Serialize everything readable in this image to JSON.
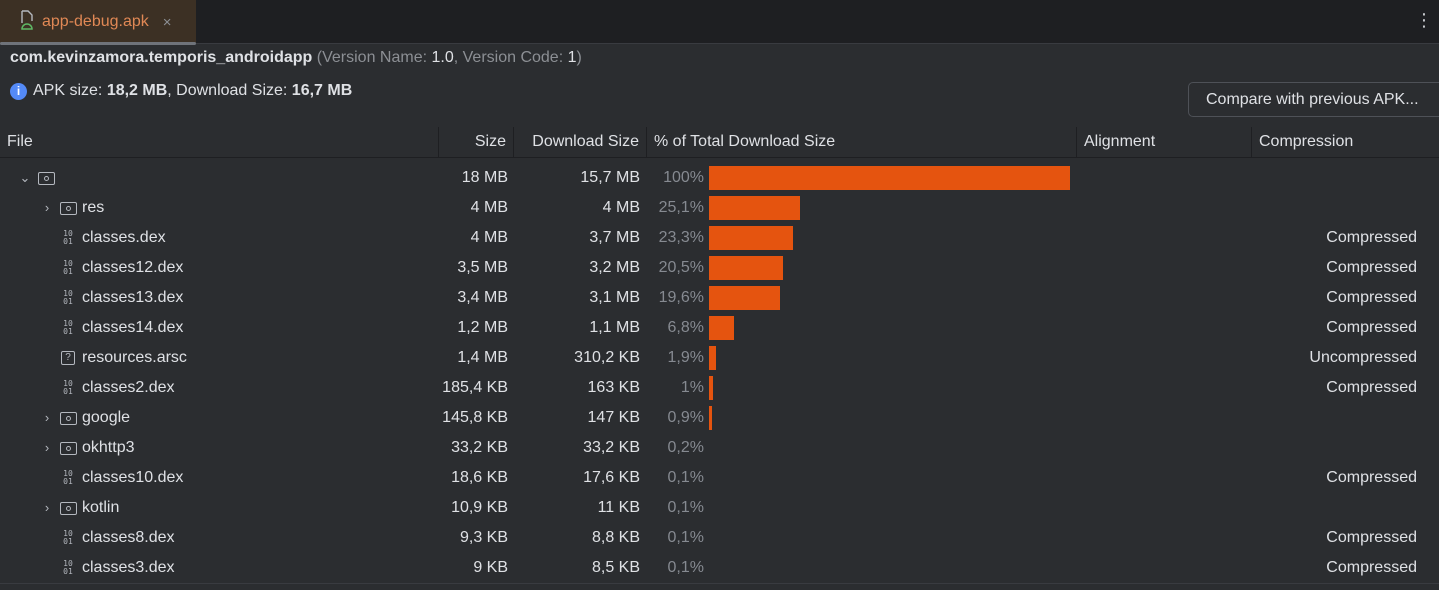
{
  "tab": {
    "label": "app-debug.apk",
    "close": "×"
  },
  "header": {
    "package": "com.kevinzamora.temporis_androidapp",
    "version_name_label": "(Version Name: ",
    "version_name": "1.0",
    "version_code_label": ", Version Code: ",
    "version_code": "1",
    "close_paren": ")"
  },
  "summary": {
    "apk_label": "APK size: ",
    "apk_size": "18,2 MB",
    "dl_label": ", Download Size: ",
    "dl_size": "16,7 MB"
  },
  "compare_button": "Compare with previous APK...",
  "columns": [
    "File",
    "Size",
    "Download Size",
    "% of Total Download Size",
    "Alignment",
    "Compression"
  ],
  "accent": "#e5540f",
  "rows": [
    {
      "name": "",
      "icon": "folder",
      "expand": "down",
      "depth": 0,
      "size": "18 MB",
      "download": "15,7 MB",
      "percent": "100%",
      "pct": 100,
      "compression": ""
    },
    {
      "name": "res",
      "icon": "res-folder",
      "expand": "right",
      "depth": 1,
      "size": "4 MB",
      "download": "4 MB",
      "percent": "25,1%",
      "pct": 25.1,
      "compression": ""
    },
    {
      "name": "classes.dex",
      "icon": "binary",
      "expand": "",
      "depth": 1,
      "size": "4 MB",
      "download": "3,7 MB",
      "percent": "23,3%",
      "pct": 23.3,
      "compression": "Compressed"
    },
    {
      "name": "classes12.dex",
      "icon": "binary",
      "expand": "",
      "depth": 1,
      "size": "3,5 MB",
      "download": "3,2 MB",
      "percent": "20,5%",
      "pct": 20.5,
      "compression": "Compressed"
    },
    {
      "name": "classes13.dex",
      "icon": "binary",
      "expand": "",
      "depth": 1,
      "size": "3,4 MB",
      "download": "3,1 MB",
      "percent": "19,6%",
      "pct": 19.6,
      "compression": "Compressed"
    },
    {
      "name": "classes14.dex",
      "icon": "binary",
      "expand": "",
      "depth": 1,
      "size": "1,2 MB",
      "download": "1,1 MB",
      "percent": "6,8%",
      "pct": 6.8,
      "compression": "Compressed"
    },
    {
      "name": "resources.arsc",
      "icon": "unknown",
      "expand": "",
      "depth": 1,
      "size": "1,4 MB",
      "download": "310,2 KB",
      "percent": "1,9%",
      "pct": 1.9,
      "compression": "Uncompressed"
    },
    {
      "name": "classes2.dex",
      "icon": "binary",
      "expand": "",
      "depth": 1,
      "size": "185,4 KB",
      "download": "163 KB",
      "percent": "1%",
      "pct": 1,
      "compression": "Compressed"
    },
    {
      "name": "google",
      "icon": "folder",
      "expand": "right",
      "depth": 1,
      "size": "145,8 KB",
      "download": "147 KB",
      "percent": "0,9%",
      "pct": 0.9,
      "compression": ""
    },
    {
      "name": "okhttp3",
      "icon": "folder",
      "expand": "right",
      "depth": 1,
      "size": "33,2 KB",
      "download": "33,2 KB",
      "percent": "0,2%",
      "pct": 0.2,
      "compression": ""
    },
    {
      "name": "classes10.dex",
      "icon": "binary",
      "expand": "",
      "depth": 1,
      "size": "18,6 KB",
      "download": "17,6 KB",
      "percent": "0,1%",
      "pct": 0.1,
      "compression": "Compressed"
    },
    {
      "name": "kotlin",
      "icon": "folder",
      "expand": "right",
      "depth": 1,
      "size": "10,9 KB",
      "download": "11 KB",
      "percent": "0,1%",
      "pct": 0.1,
      "compression": ""
    },
    {
      "name": "classes8.dex",
      "icon": "binary",
      "expand": "",
      "depth": 1,
      "size": "9,3 KB",
      "download": "8,8 KB",
      "percent": "0,1%",
      "pct": 0.1,
      "compression": "Compressed"
    },
    {
      "name": "classes3.dex",
      "icon": "binary",
      "expand": "",
      "depth": 1,
      "size": "9 KB",
      "download": "8,5 KB",
      "percent": "0,1%",
      "pct": 0.1,
      "compression": "Compressed"
    }
  ]
}
